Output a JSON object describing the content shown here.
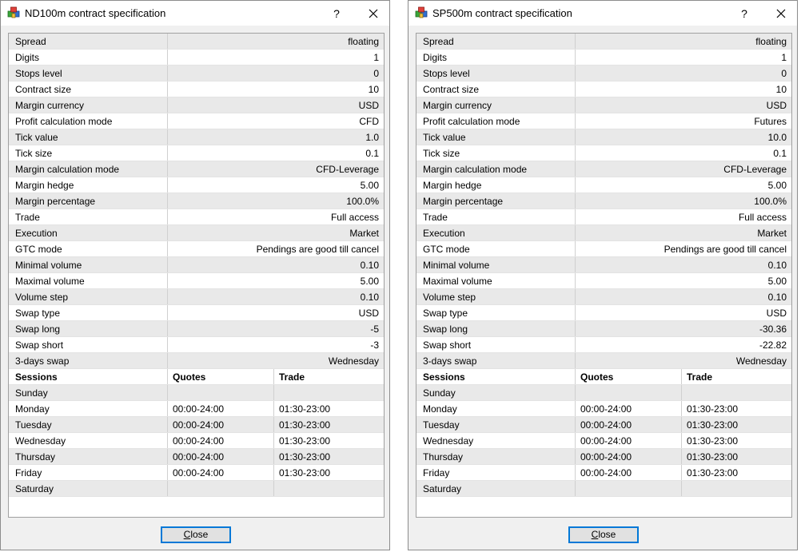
{
  "colors": {
    "accent": "#0078d7",
    "shaded_row": "#e9e9e9",
    "dialog_bg": "#f0f0f0"
  },
  "dialogs": [
    {
      "title": "ND100m contract specification",
      "icon": "app-cubes-icon",
      "help_label": "?",
      "close_label": "Close",
      "properties": [
        {
          "name": "Spread",
          "value": "floating"
        },
        {
          "name": "Digits",
          "value": "1"
        },
        {
          "name": "Stops level",
          "value": "0"
        },
        {
          "name": "Contract size",
          "value": "10"
        },
        {
          "name": "Margin currency",
          "value": "USD"
        },
        {
          "name": "Profit calculation mode",
          "value": "CFD"
        },
        {
          "name": "Tick value",
          "value": "1.0"
        },
        {
          "name": "Tick size",
          "value": "0.1"
        },
        {
          "name": "Margin calculation mode",
          "value": "CFD-Leverage"
        },
        {
          "name": "Margin hedge",
          "value": "5.00"
        },
        {
          "name": "Margin percentage",
          "value": "100.0%"
        },
        {
          "name": "Trade",
          "value": "Full access"
        },
        {
          "name": "Execution",
          "value": "Market"
        },
        {
          "name": "GTC mode",
          "value": "Pendings are good till cancel"
        },
        {
          "name": "Minimal volume",
          "value": "0.10"
        },
        {
          "name": "Maximal volume",
          "value": "5.00"
        },
        {
          "name": "Volume step",
          "value": "0.10"
        },
        {
          "name": "Swap type",
          "value": "USD"
        },
        {
          "name": "Swap long",
          "value": "-5"
        },
        {
          "name": "Swap short",
          "value": "-3"
        },
        {
          "name": "3-days swap",
          "value": "Wednesday"
        }
      ],
      "sessions_header": {
        "day": "Sessions",
        "quotes": "Quotes",
        "trade": "Trade"
      },
      "sessions": [
        {
          "day": "Sunday",
          "quotes": "",
          "trade": ""
        },
        {
          "day": "Monday",
          "quotes": "00:00-24:00",
          "trade": "01:30-23:00"
        },
        {
          "day": "Tuesday",
          "quotes": "00:00-24:00",
          "trade": "01:30-23:00"
        },
        {
          "day": "Wednesday",
          "quotes": "00:00-24:00",
          "trade": "01:30-23:00"
        },
        {
          "day": "Thursday",
          "quotes": "00:00-24:00",
          "trade": "01:30-23:00"
        },
        {
          "day": "Friday",
          "quotes": "00:00-24:00",
          "trade": "01:30-23:00"
        },
        {
          "day": "Saturday",
          "quotes": "",
          "trade": ""
        }
      ]
    },
    {
      "title": "SP500m contract specification",
      "icon": "app-cubes-icon",
      "help_label": "?",
      "close_label": "Close",
      "properties": [
        {
          "name": "Spread",
          "value": "floating"
        },
        {
          "name": "Digits",
          "value": "1"
        },
        {
          "name": "Stops level",
          "value": "0"
        },
        {
          "name": "Contract size",
          "value": "10"
        },
        {
          "name": "Margin currency",
          "value": "USD"
        },
        {
          "name": "Profit calculation mode",
          "value": "Futures"
        },
        {
          "name": "Tick value",
          "value": "10.0"
        },
        {
          "name": "Tick size",
          "value": "0.1"
        },
        {
          "name": "Margin calculation mode",
          "value": "CFD-Leverage"
        },
        {
          "name": "Margin hedge",
          "value": "5.00"
        },
        {
          "name": "Margin percentage",
          "value": "100.0%"
        },
        {
          "name": "Trade",
          "value": "Full access"
        },
        {
          "name": "Execution",
          "value": "Market"
        },
        {
          "name": "GTC mode",
          "value": "Pendings are good till cancel"
        },
        {
          "name": "Minimal volume",
          "value": "0.10"
        },
        {
          "name": "Maximal volume",
          "value": "5.00"
        },
        {
          "name": "Volume step",
          "value": "0.10"
        },
        {
          "name": "Swap type",
          "value": "USD"
        },
        {
          "name": "Swap long",
          "value": "-30.36"
        },
        {
          "name": "Swap short",
          "value": "-22.82"
        },
        {
          "name": "3-days swap",
          "value": "Wednesday"
        }
      ],
      "sessions_header": {
        "day": "Sessions",
        "quotes": "Quotes",
        "trade": "Trade"
      },
      "sessions": [
        {
          "day": "Sunday",
          "quotes": "",
          "trade": ""
        },
        {
          "day": "Monday",
          "quotes": "00:00-24:00",
          "trade": "01:30-23:00"
        },
        {
          "day": "Tuesday",
          "quotes": "00:00-24:00",
          "trade": "01:30-23:00"
        },
        {
          "day": "Wednesday",
          "quotes": "00:00-24:00",
          "trade": "01:30-23:00"
        },
        {
          "day": "Thursday",
          "quotes": "00:00-24:00",
          "trade": "01:30-23:00"
        },
        {
          "day": "Friday",
          "quotes": "00:00-24:00",
          "trade": "01:30-23:00"
        },
        {
          "day": "Saturday",
          "quotes": "",
          "trade": ""
        }
      ]
    }
  ]
}
